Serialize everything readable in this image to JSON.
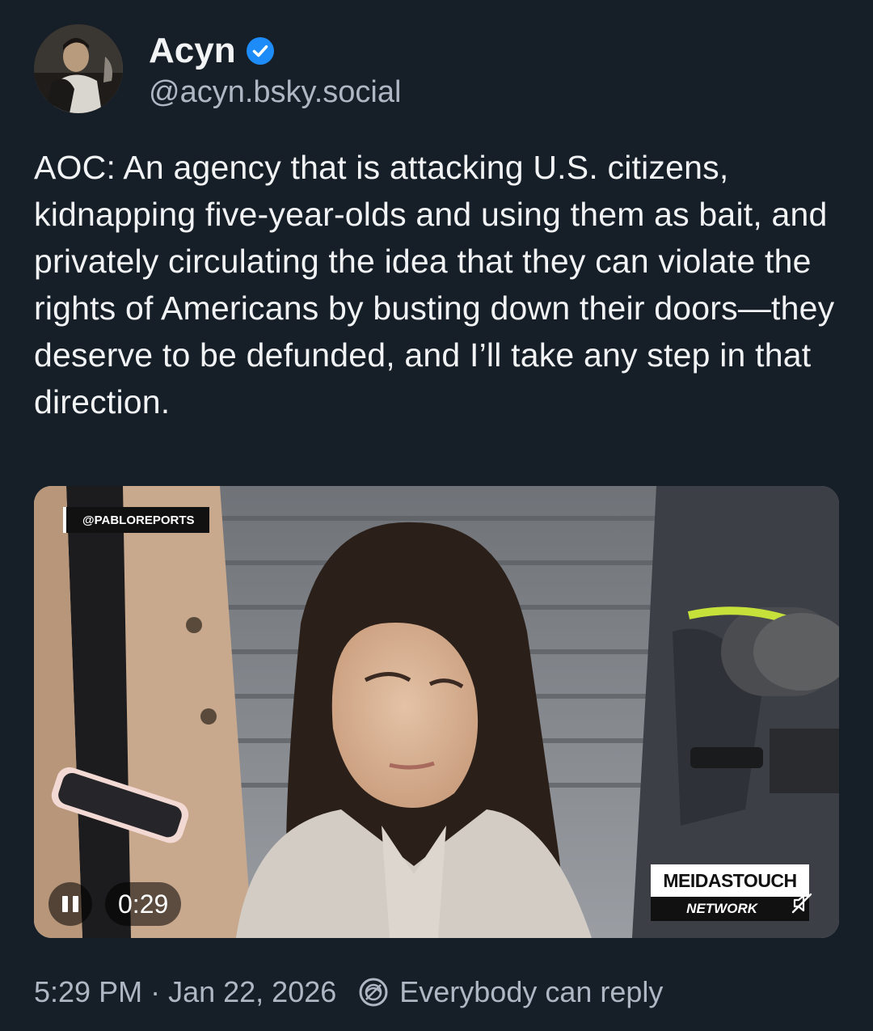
{
  "author": {
    "display_name": "Acyn",
    "handle": "@acyn.bsky.social",
    "verified": true,
    "verified_color": "#1d8cf8"
  },
  "post": {
    "text": "AOC: An agency that is attacking U.S. citizens, kidnapping five-year-olds and using them as bait, and privately circulating the idea that they can violate the rights of Americans by busting down their doors—they deserve to be defunded, and I’ll take any step in that direction."
  },
  "video": {
    "source_tag": "@PABLOREPORTS",
    "time": "0:29",
    "brand_top": "MEIDASTOUCH",
    "brand_bottom": "NETWORK",
    "state": "playing",
    "muted": true
  },
  "footer": {
    "time": "5:29 PM",
    "separator": "·",
    "date": "Jan 22, 2026",
    "reply_setting": "Everybody can reply"
  },
  "icons": [
    "verified-badge-icon",
    "pause-icon",
    "mute-icon",
    "reply-settings-icon"
  ]
}
